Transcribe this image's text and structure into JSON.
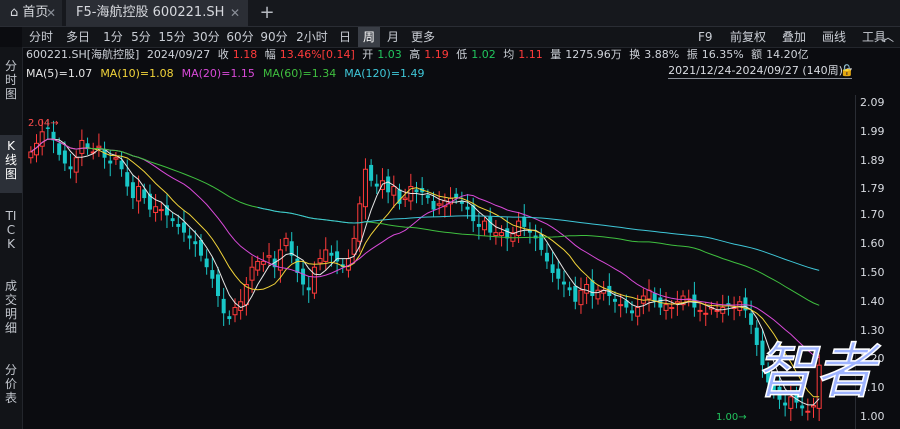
{
  "tabs": {
    "home_label": "首页",
    "stock_label": "F5-海航控股 600221.SH",
    "add_label": "+"
  },
  "periods": [
    "分时",
    "多日",
    "1分",
    "5分",
    "15分",
    "30分",
    "60分",
    "90分",
    "2小时",
    "日",
    "周",
    "月",
    "更多"
  ],
  "active_period": "周",
  "right_tools": [
    "F9",
    "前复权",
    "叠加",
    "画线",
    "工具"
  ],
  "sidebar": [
    "分时图",
    "K线图",
    "TICK",
    "成交明细",
    "分价表"
  ],
  "info": {
    "code": "600221.SH[海航控股]",
    "date": "2024/09/27",
    "close_label": "收",
    "close": "1.18",
    "amp_label": "幅",
    "amp": "13.46%[0.14]",
    "open_label": "开",
    "open": "1.03",
    "high_label": "高",
    "high": "1.19",
    "low_label": "低",
    "low": "1.02",
    "avg_label": "均",
    "avg": "1.11",
    "vol_label": "量",
    "vol": "1275.96万",
    "turn_label": "换",
    "turn": "3.88%",
    "swing_label": "振",
    "swing": "16.35%",
    "amount_label": "额",
    "amount": "14.20亿"
  },
  "range_text": "2021/12/24-2024/09/27 (140周)",
  "ma": [
    {
      "text": "MA(5)=1.07",
      "color": "#e6e6e6"
    },
    {
      "text": "MA(10)=1.08",
      "color": "#f2d43a"
    },
    {
      "text": "MA(20)=1.15",
      "color": "#d94ad9"
    },
    {
      "text": "MA(60)=1.34",
      "color": "#3fbf3f"
    },
    {
      "text": "MA(120)=1.49",
      "color": "#3fc7d8"
    }
  ],
  "price_axis": {
    "labels": [
      "2.09",
      "1.99",
      "1.89",
      "1.79",
      "1.70",
      "1.60",
      "1.50",
      "1.40",
      "1.30",
      "1.20",
      "1.10",
      "1.00"
    ],
    "values": [
      2.09,
      1.99,
      1.89,
      1.79,
      1.7,
      1.6,
      1.5,
      1.4,
      1.3,
      1.2,
      1.1,
      1.0
    ]
  },
  "max_label": "2.04",
  "min_label": "1.00",
  "colors": {
    "up": "#ff3b3b",
    "down": "#19c7c7"
  },
  "watermark": "智者",
  "chart_data": {
    "type": "candlestick",
    "y_min": 1.0,
    "y_max": 2.09,
    "closes": [
      1.92,
      1.95,
      1.99,
      2.0,
      1.96,
      1.91,
      1.88,
      1.86,
      1.9,
      1.96,
      1.93,
      1.92,
      1.94,
      1.9,
      1.88,
      1.9,
      1.86,
      1.8,
      1.76,
      1.8,
      1.76,
      1.72,
      1.73,
      1.72,
      1.7,
      1.68,
      1.66,
      1.64,
      1.62,
      1.6,
      1.56,
      1.52,
      1.48,
      1.42,
      1.36,
      1.34,
      1.38,
      1.4,
      1.46,
      1.52,
      1.54,
      1.54,
      1.56,
      1.52,
      1.58,
      1.62,
      1.56,
      1.5,
      1.46,
      1.44,
      1.52,
      1.55,
      1.58,
      1.56,
      1.54,
      1.52,
      1.55,
      1.62,
      1.74,
      1.86,
      1.82,
      1.8,
      1.82,
      1.78,
      1.8,
      1.74,
      1.76,
      1.8,
      1.78,
      1.78,
      1.76,
      1.72,
      1.74,
      1.75,
      1.76,
      1.76,
      1.74,
      1.72,
      1.68,
      1.66,
      1.68,
      1.64,
      1.64,
      1.64,
      1.62,
      1.64,
      1.68,
      1.66,
      1.64,
      1.62,
      1.58,
      1.54,
      1.5,
      1.48,
      1.46,
      1.44,
      1.4,
      1.44,
      1.46,
      1.42,
      1.44,
      1.44,
      1.42,
      1.4,
      1.39,
      1.38,
      1.36,
      1.38,
      1.42,
      1.44,
      1.4,
      1.38,
      1.39,
      1.38,
      1.4,
      1.42,
      1.41,
      1.38,
      1.37,
      1.36,
      1.38,
      1.37,
      1.38,
      1.39,
      1.38,
      1.4,
      1.37,
      1.32,
      1.25,
      1.18,
      1.12,
      1.09,
      1.06,
      1.04,
      1.07,
      1.05,
      1.03,
      1.02,
      1.04,
      1.18
    ]
  }
}
